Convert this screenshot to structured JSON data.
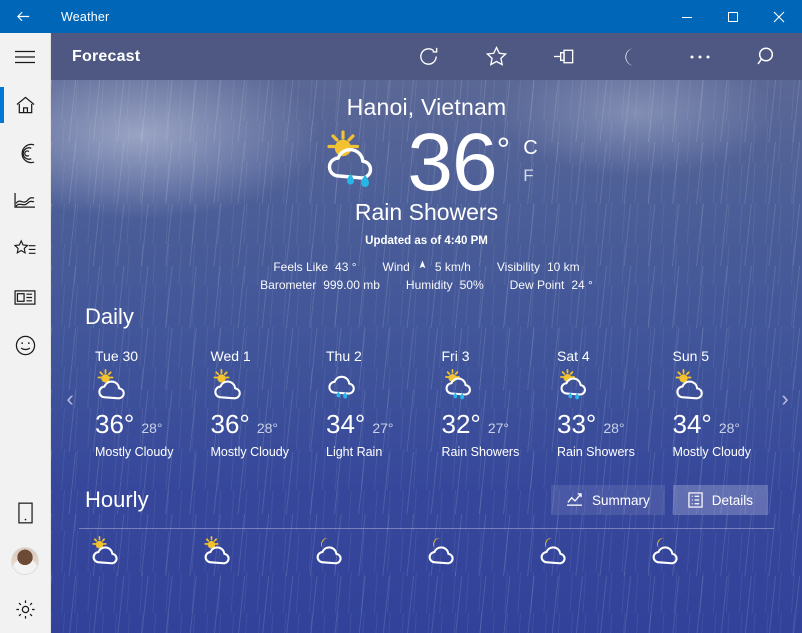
{
  "window": {
    "app_title": "Weather",
    "back_icon": "back-arrow-icon",
    "minimize_label": "Minimize",
    "maximize_label": "Maximize",
    "close_label": "Close",
    "accent_color": "#0067b8"
  },
  "sidebar": {
    "menu_label": "Navigation",
    "items": [
      {
        "name": "hamburger",
        "label": "Menu",
        "selected": false
      },
      {
        "name": "home",
        "label": "Forecast",
        "selected": true
      },
      {
        "name": "maps",
        "label": "Maps",
        "selected": false
      },
      {
        "name": "historical",
        "label": "Historical Weather",
        "selected": false
      },
      {
        "name": "favorites",
        "label": "Favorites",
        "selected": false
      },
      {
        "name": "news",
        "label": "News",
        "selected": false
      },
      {
        "name": "life",
        "label": "Life",
        "selected": false
      },
      {
        "name": "phone",
        "label": "Send to phone",
        "selected": false
      },
      {
        "name": "account",
        "label": "Account",
        "selected": false
      },
      {
        "name": "settings",
        "label": "Settings",
        "selected": false
      }
    ]
  },
  "command_bar": {
    "title": "Forecast",
    "buttons": [
      {
        "name": "refresh",
        "label": "Refresh"
      },
      {
        "name": "favorite",
        "label": "Add to Favorites"
      },
      {
        "name": "pin",
        "label": "Pin to Start"
      },
      {
        "name": "night-mode",
        "label": "Night Mode"
      },
      {
        "name": "more",
        "label": "See more"
      },
      {
        "name": "search",
        "label": "Search"
      }
    ]
  },
  "current": {
    "location": "Hanoi, Vietnam",
    "temperature": "36",
    "degree": "°",
    "unit_celsius": "C",
    "unit_fahrenheit": "F",
    "condition": "Rain Showers",
    "icon": "sun-behind-rain-cloud-icon",
    "updated": "Updated as of 4:40 PM",
    "details": [
      [
        {
          "key": "Feels Like",
          "value": "43 °"
        },
        {
          "key": "Wind",
          "value": "5 km/h",
          "icon": "wind-direction-arrow-icon"
        },
        {
          "key": "Visibility",
          "value": "10 km"
        }
      ],
      [
        {
          "key": "Barometer",
          "value": "999.00 mb"
        },
        {
          "key": "Humidity",
          "value": "50%"
        },
        {
          "key": "Dew Point",
          "value": "24 °"
        }
      ]
    ]
  },
  "daily": {
    "heading": "Daily",
    "prev_label": "‹",
    "next_label": "›",
    "days": [
      {
        "name": "Tue 30",
        "icon": "sun-behind-cloud-icon",
        "high": "36°",
        "low": "28°",
        "desc": "Mostly Cloudy",
        "selected": true
      },
      {
        "name": "Wed 1",
        "icon": "sun-behind-cloud-icon",
        "high": "36°",
        "low": "28°",
        "desc": "Mostly Cloudy",
        "selected": false
      },
      {
        "name": "Thu 2",
        "icon": "rain-cloud-icon",
        "high": "34°",
        "low": "27°",
        "desc": "Light Rain",
        "selected": false
      },
      {
        "name": "Fri 3",
        "icon": "sun-behind-rain-cloud-icon",
        "high": "32°",
        "low": "27°",
        "desc": "Rain Showers",
        "selected": false
      },
      {
        "name": "Sat 4",
        "icon": "sun-behind-rain-cloud-icon",
        "high": "33°",
        "low": "28°",
        "desc": "Rain Showers",
        "selected": false
      },
      {
        "name": "Sun 5",
        "icon": "sun-behind-cloud-icon",
        "high": "34°",
        "low": "28°",
        "desc": "Mostly Cloudy",
        "selected": false
      }
    ]
  },
  "hourly": {
    "heading": "Hourly",
    "summary_label": "Summary",
    "details_label": "Details",
    "summary_icon": "line-chart-icon",
    "details_icon": "list-details-icon",
    "active_view": "Details",
    "hours": [
      {
        "icon": "sun-behind-cloud-icon"
      },
      {
        "icon": "sun-behind-cloud-icon"
      },
      {
        "icon": "moon-behind-cloud-icon"
      },
      {
        "icon": "moon-behind-cloud-icon"
      },
      {
        "icon": "moon-behind-cloud-icon"
      },
      {
        "icon": "moon-behind-cloud-icon"
      }
    ]
  }
}
